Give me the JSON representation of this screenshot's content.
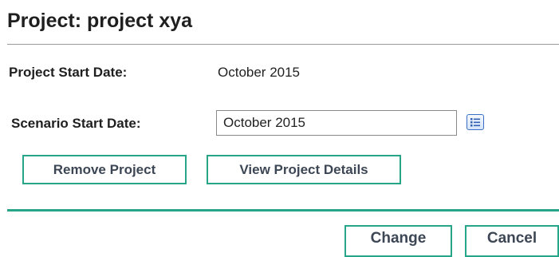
{
  "page": {
    "title": "Project: project xya"
  },
  "fields": {
    "project_start_label": "Project Start Date:",
    "project_start_value": "October 2015",
    "scenario_start_label": "Scenario Start Date:",
    "scenario_start_value": "October 2015"
  },
  "actions": {
    "remove_project_label": "Remove Project",
    "view_details_label": "View Project Details"
  },
  "footer": {
    "change_label": "Change",
    "cancel_label": "Cancel"
  },
  "colors": {
    "accent": "#26a589",
    "button_text": "#3d4654",
    "calendar_icon": "#3a6fc4"
  },
  "icons": {
    "date_picker": "calendar-list-icon"
  }
}
